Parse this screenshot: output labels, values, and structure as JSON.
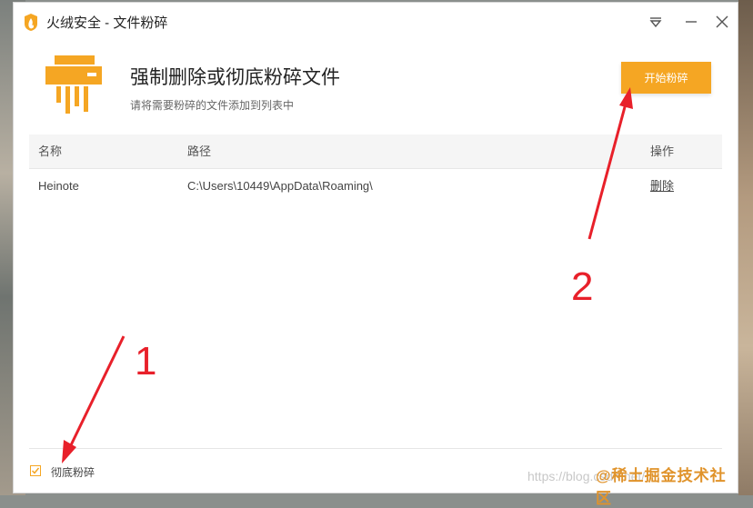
{
  "window": {
    "title": "火绒安全 - 文件粉碎",
    "controls": {
      "menu_icon": "dropdown-triangle-icon",
      "minimize_icon": "minimize-icon",
      "close_icon": "close-icon"
    }
  },
  "header": {
    "icon": "shredder-icon",
    "title": "强制删除或彻底粉碎文件",
    "subtitle": "请将需要粉碎的文件添加到列表中",
    "start_button": "开始粉碎"
  },
  "table": {
    "columns": [
      "名称",
      "路径",
      "操作"
    ],
    "rows": [
      {
        "name": "Heinote",
        "path": "C:\\Users\\10449\\AppData\\Roaming\\",
        "action": "删除"
      }
    ]
  },
  "footer": {
    "checkbox_label": "彻底粉碎",
    "checkbox_checked": true,
    "watermark_url": "https://blog.csdn.net/",
    "watermark_brand": "@稀土掘金技术社区"
  },
  "annotations": {
    "label_1": "1",
    "label_2": "2",
    "arrow_color": "#e8202a"
  },
  "colors": {
    "accent": "#f5a623"
  }
}
